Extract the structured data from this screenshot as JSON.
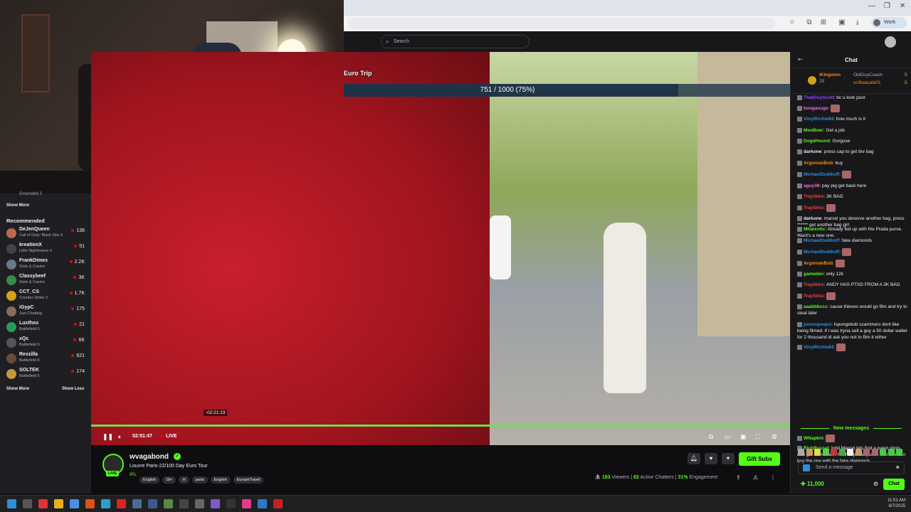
{
  "browser": {
    "profile_label": "Work",
    "window_controls": [
      "—",
      "❐",
      "✕"
    ]
  },
  "topbar": {
    "search_placeholder": "Search"
  },
  "sidebar": {
    "followed_last": {
      "game": "Grounded 2"
    },
    "show_more": "Show More",
    "recommended_title": "Recommended",
    "recommended": [
      {
        "name": "DeJenQueen",
        "game": "Call of Duty: Black Ops 6",
        "viewers": "136",
        "avatar_color": "#b96a4a"
      },
      {
        "name": "kreationX",
        "game": "Little Nightmares II",
        "viewers": "51",
        "avatar_color": "#444444"
      },
      {
        "name": "FrankDimes",
        "game": "Slots & Casino",
        "viewers": "2.2K",
        "avatar_color": "#6a7a8a"
      },
      {
        "name": "Classybeef",
        "game": "Slots & Casino",
        "viewers": "3K",
        "avatar_color": "#3a8a4a"
      },
      {
        "name": "CCT_CS",
        "game": "Counter-Strike 2",
        "viewers": "1.7K",
        "avatar_color": "#d6a21a"
      },
      {
        "name": "iGypC",
        "game": "Just Chatting",
        "viewers": "175",
        "avatar_color": "#8a6a5a"
      },
      {
        "name": "Luxthos",
        "game": "Battlefield 6",
        "viewers": "21",
        "avatar_color": "#2a9a5a"
      },
      {
        "name": "xQc",
        "game": "Battlefield 6",
        "viewers": "6K",
        "avatar_color": "#555555"
      },
      {
        "name": "Rexzilla",
        "game": "Battlefield 6",
        "viewers": "621",
        "avatar_color": "#6a4a3a"
      },
      {
        "name": "SOLTEK",
        "game": "Battlefield 6",
        "viewers": "174",
        "avatar_color": "#c49a3a"
      }
    ],
    "show_more_bottom": "Show More",
    "show_less": "Show Less"
  },
  "video": {
    "overlay_title": "Euro Trip",
    "goal_text": "751 / 1000 (75%)",
    "goal_fraction": 0.75,
    "scrub_tooltip": "-02:21:23",
    "elapsed": "02:51:47",
    "live_label": "LIVE"
  },
  "channel": {
    "name": "wvagabond",
    "live_badge": "LIVE",
    "title": "Louvre Paris-22/100 Day Euro Tour",
    "category": "IRL",
    "tags": [
      "English",
      "18+",
      "irl",
      "paris",
      "English",
      "EuropeTravel"
    ],
    "gift_subs": "Gift Subs",
    "viewers": "183",
    "viewers_label": "Viewers",
    "chatters": "62",
    "chatters_label": "Active Chatters",
    "engagement": "31%",
    "engagement_label": "Engagement"
  },
  "chat": {
    "title": "Chat",
    "pinned": [
      {
        "name": "iKingston",
        "count": "25"
      },
      {
        "name": "OldGuyCoach",
        "count": "5"
      },
      {
        "name": "scifiwasabi01",
        "count": "5"
      }
    ],
    "messages": [
      {
        "user": "ThatGuyScott",
        "text": "bc u look poor",
        "color": "#9146ff"
      },
      {
        "user": "boogasugs",
        "text": "",
        "color": "#ff6ad5",
        "emote": true
      },
      {
        "user": "VinylRichie84",
        "text": "how much is it",
        "color": "#2b8fd8"
      },
      {
        "user": "MoeBoer",
        "text": "Get a job",
        "color": "#53fc18"
      },
      {
        "user": "DogeHound",
        "text": "Gorguse",
        "color": "#53fc18"
      },
      {
        "user": "darkone",
        "text": "press cap to get the bag",
        "color": "#efeff1"
      },
      {
        "user": "ArgonianBob",
        "text": "buy",
        "color": "#ff8c00"
      },
      {
        "user": "MichaelDudikoff",
        "text": "",
        "color": "#2b8fd8",
        "emote": true
      },
      {
        "user": "aguy36",
        "text": "pay pig get back here",
        "color": "#ff6ad5"
      },
      {
        "user": "TraySimz",
        "text": "3K BAG",
        "color": "#ff4040"
      },
      {
        "user": "TraySimz",
        "text": "",
        "color": "#ff4040",
        "emote": true
      },
      {
        "user": "darkone",
        "text": "marsel you deserve another bag, press ****** get another bag girl",
        "color": "#efeff1"
      },
      {
        "user": "Mhatxotic",
        "text": "Already fed up with the Prada purse. Want's a new one.",
        "color": "#53fc18"
      },
      {
        "user": "MichaelDudikoff",
        "text": "fake diamonds",
        "color": "#2b8fd8"
      },
      {
        "user": "MichaelDudikoff",
        "text": "",
        "color": "#2b8fd8",
        "emote": true
      },
      {
        "user": "ArgonianBob",
        "text": "",
        "color": "#ff8c00",
        "emote": true
      },
      {
        "user": "gamedev",
        "text": "only 12k",
        "color": "#53fc18"
      },
      {
        "user": "TraySimz",
        "text": "ANDY HAS PTSD FROM A 3K BAG",
        "color": "#ff4040"
      },
      {
        "user": "TraySimz",
        "text": "",
        "color": "#ff4040",
        "emote": true
      },
      {
        "user": "aaabbbccc",
        "text": "cause thieves would go film and try to steal later",
        "color": "#53fc18"
      },
      {
        "user": "poooopeepo",
        "text": "Ispongebob scammers dont like being filmed. if i was tryna sell a guy a 50 dollar wallet for 2 thousand id ask you not to film it either",
        "color": "#2b8fd8"
      },
      {
        "user": "VinylRichie84",
        "text": "",
        "color": "#2b8fd8",
        "emote": true
      }
    ],
    "new_messages_label": "New messages",
    "new_messages": [
      {
        "user": "WNapkin",
        "text": "",
        "color": "#53fc18",
        "emote": true
      },
      {
        "user": "RichRussel",
        "text": "Iphil Marcel lets find a pawn shop and get some cash for that prada purse. then we can buy the one with the fake diamonds",
        "color": "#53fc18"
      },
      {
        "user": "MichaelDudikoff",
        "text": "",
        "color": "#2b8fd8",
        "emote": true
      }
    ],
    "input_placeholder": "Send a message",
    "points": "11,000",
    "send_label": "Chat"
  },
  "taskbar": {
    "time": "11:51 AM",
    "date": "8/7/2025"
  }
}
